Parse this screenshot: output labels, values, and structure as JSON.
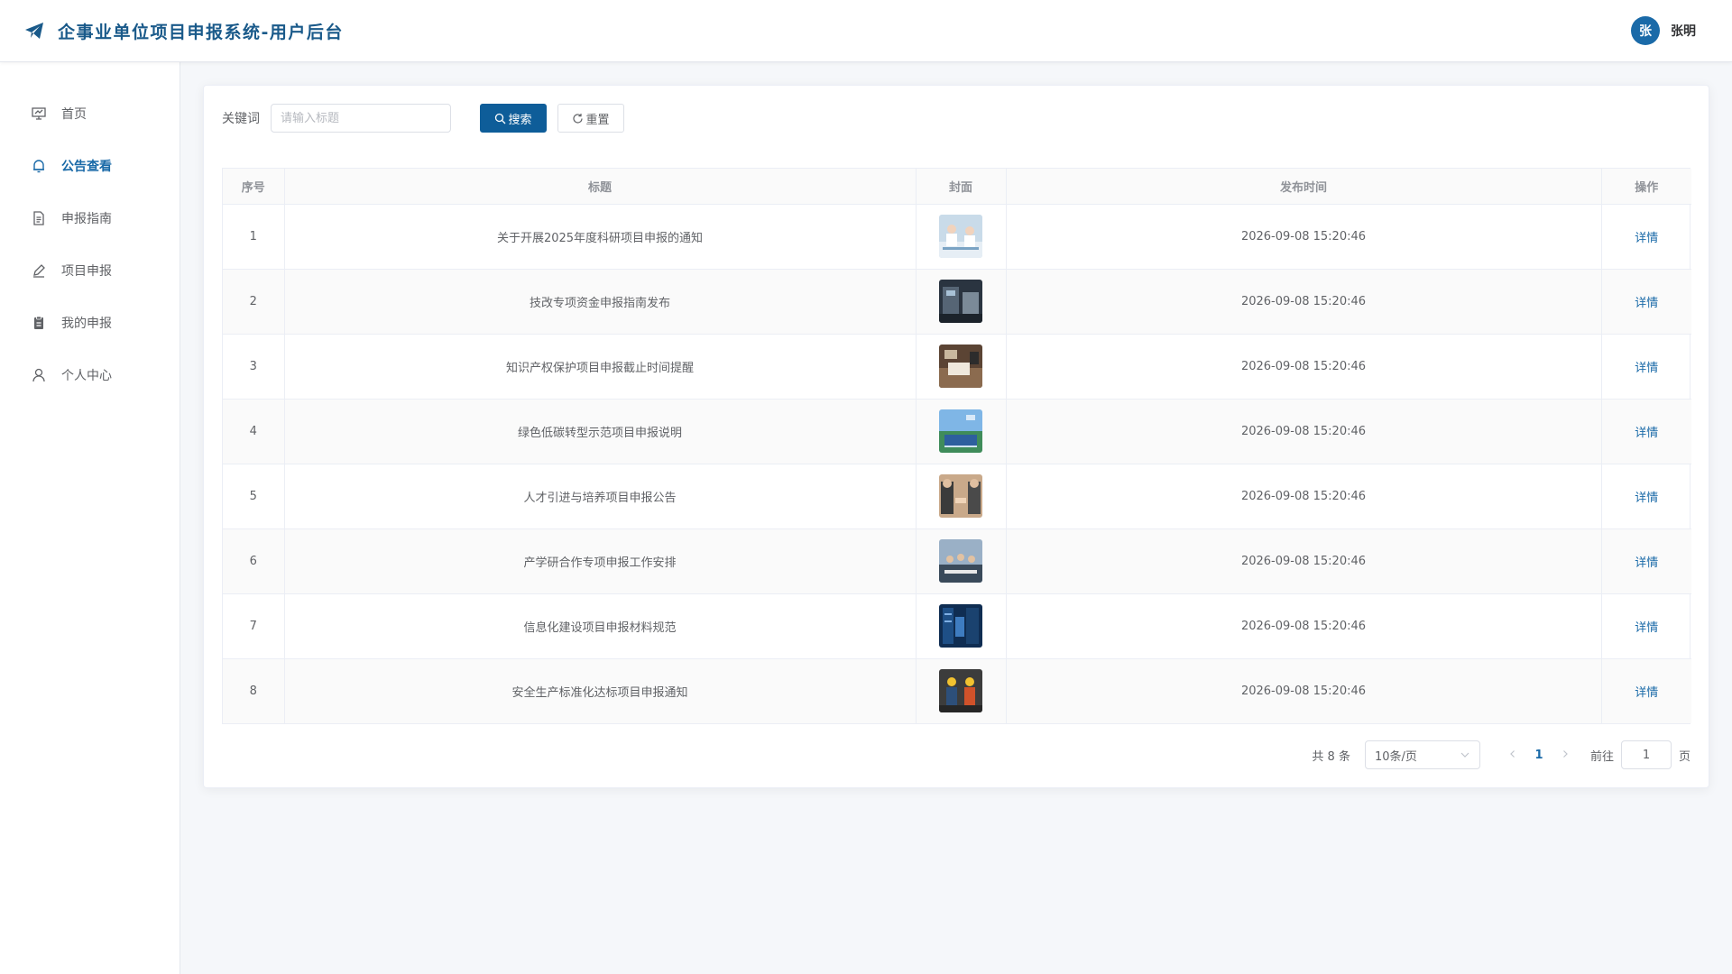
{
  "header": {
    "title": "企事业单位项目申报系统-用户后台",
    "logo_icon": "paper-plane-icon",
    "user": {
      "avatar_text": "张",
      "name": "张明"
    }
  },
  "colors": {
    "brand": "#1a5a8a",
    "primary": "#0e5d99",
    "link": "#1a6aa8"
  },
  "sidebar": {
    "items": [
      {
        "label": "首页",
        "icon": "presentation-icon",
        "active": false
      },
      {
        "label": "公告查看",
        "icon": "bell-icon",
        "active": true
      },
      {
        "label": "申报指南",
        "icon": "document-icon",
        "active": false
      },
      {
        "label": "项目申报",
        "icon": "pen-icon",
        "active": false
      },
      {
        "label": "我的申报",
        "icon": "clipboard-icon",
        "active": false
      },
      {
        "label": "个人中心",
        "icon": "user-icon",
        "active": false
      }
    ]
  },
  "search": {
    "label": "关键词",
    "placeholder": "请输入标题",
    "value": "",
    "search_label": "搜索",
    "reset_label": "重置"
  },
  "table": {
    "columns": [
      "序号",
      "标题",
      "封面",
      "发布时间",
      "操作"
    ],
    "action_label": "详情",
    "rows": [
      {
        "index": "1",
        "title": "关于开展2025年度科研项目申报的通知",
        "time": "2026-09-08 15:20:46",
        "cover": "laboratory"
      },
      {
        "index": "2",
        "title": "技改专项资金申报指南发布",
        "time": "2026-09-08 15:20:46",
        "cover": "factory"
      },
      {
        "index": "3",
        "title": "知识产权保护项目申报截止时间提醒",
        "time": "2026-09-08 15:20:46",
        "cover": "desk"
      },
      {
        "index": "4",
        "title": "绿色低碳转型示范项目申报说明",
        "time": "2026-09-08 15:20:46",
        "cover": "solar"
      },
      {
        "index": "5",
        "title": "人才引进与培养项目申报公告",
        "time": "2026-09-08 15:20:46",
        "cover": "handshake"
      },
      {
        "index": "6",
        "title": "产学研合作专项申报工作安排",
        "time": "2026-09-08 15:20:46",
        "cover": "meeting"
      },
      {
        "index": "7",
        "title": "信息化建设项目申报材料规范",
        "time": "2026-09-08 15:20:46",
        "cover": "server"
      },
      {
        "index": "8",
        "title": "安全生产标准化达标项目申报通知",
        "time": "2026-09-08 15:20:46",
        "cover": "workers"
      }
    ]
  },
  "pagination": {
    "total_text": "共 8 条",
    "page_size": "10条/页",
    "current_page": "1",
    "goto_label": "前往",
    "jump_value": "1",
    "page_unit": "页"
  }
}
